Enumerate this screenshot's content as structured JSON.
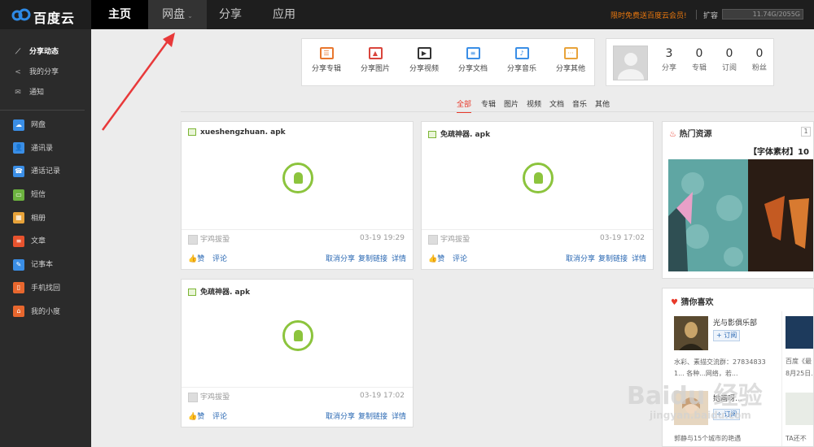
{
  "app": {
    "logo_text": "百度云"
  },
  "topnav": {
    "items": [
      {
        "label": "主页"
      },
      {
        "label": "网盘"
      },
      {
        "label": "分享"
      },
      {
        "label": "应用"
      }
    ],
    "promo": "限时免费送百度云会员!",
    "expand": "扩容",
    "quota": "11.74G/2055G"
  },
  "sidebar": {
    "top_items": [
      {
        "label": "分享动态",
        "icon": "activity-icon"
      },
      {
        "label": "我的分享",
        "icon": "share-icon"
      },
      {
        "label": "通知",
        "icon": "mail-icon"
      }
    ],
    "apps": [
      {
        "label": "网盘",
        "icon": "cloud-icon",
        "color": "#3a8ee6"
      },
      {
        "label": "通讯录",
        "icon": "contacts-icon",
        "color": "#3a8ee6"
      },
      {
        "label": "通话记录",
        "icon": "call-log-icon",
        "color": "#3a8ee6"
      },
      {
        "label": "短信",
        "icon": "sms-icon",
        "color": "#6cb33f"
      },
      {
        "label": "相册",
        "icon": "photo-icon",
        "color": "#e8a33a"
      },
      {
        "label": "文章",
        "icon": "article-icon",
        "color": "#e8532e"
      },
      {
        "label": "记事本",
        "icon": "notepad-icon",
        "color": "#3a8ee6"
      },
      {
        "label": "手机找回",
        "icon": "phone-find-icon",
        "color": "#e8672e"
      },
      {
        "label": "我的小度",
        "icon": "home-icon",
        "color": "#e8672e"
      }
    ]
  },
  "share_tools": [
    {
      "label": "分享专辑",
      "color": "#e8772e"
    },
    {
      "label": "分享图片",
      "color": "#d9453c"
    },
    {
      "label": "分享视频",
      "color": "#333333"
    },
    {
      "label": "分享文档",
      "color": "#3a8ee6"
    },
    {
      "label": "分享音乐",
      "color": "#3a8ee6"
    },
    {
      "label": "分享其他",
      "color": "#e8a33a"
    }
  ],
  "profile": {
    "stats": [
      {
        "value": "3",
        "label": "分享"
      },
      {
        "value": "0",
        "label": "专辑"
      },
      {
        "value": "0",
        "label": "订阅"
      },
      {
        "value": "0",
        "label": "粉丝"
      }
    ]
  },
  "filter_tabs": [
    "全部",
    "专辑",
    "图片",
    "视频",
    "文档",
    "音乐",
    "其他"
  ],
  "cards": [
    {
      "filename": "xueshengzhuan. apk",
      "user": "宇鸡拔蛩",
      "date": "03-19 19:29"
    },
    {
      "filename": "免疏神器. apk",
      "user": "宇鸡拔蛩",
      "date": "03-19 17:02"
    },
    {
      "filename": "免疏神器. apk",
      "user": "宇鸡拔蛩",
      "date": "03-19 17:02"
    }
  ],
  "card_actions": {
    "like": "赞",
    "comment": "评论",
    "cancel_share": "取消分享",
    "copy_link": "复制链接",
    "details": "详情"
  },
  "hot": {
    "title": "热门资源",
    "page": "1",
    "subtitle": "【字体素材】10"
  },
  "guess": {
    "title": "猜你喜欢",
    "items": [
      {
        "name": "光与影俱乐部",
        "subscribe": "+ 订阅",
        "desc1": "水彩、素描交流群：27834833",
        "desc2": "1... 各种...网络，若..."
      },
      {
        "name": "她画呀...",
        "subscribe": "+ 订阅",
        "desc1": "郭静与15个城市的艳遇",
        "desc2": ""
      }
    ],
    "col2": [
      {
        "desc": "百度《最"
      },
      {
        "desc": "8月25日..."
      },
      {
        "desc": "TA还不"
      }
    ]
  },
  "watermark": {
    "brand": "Baidu 经验",
    "url": "jingyan.baidu.com"
  }
}
